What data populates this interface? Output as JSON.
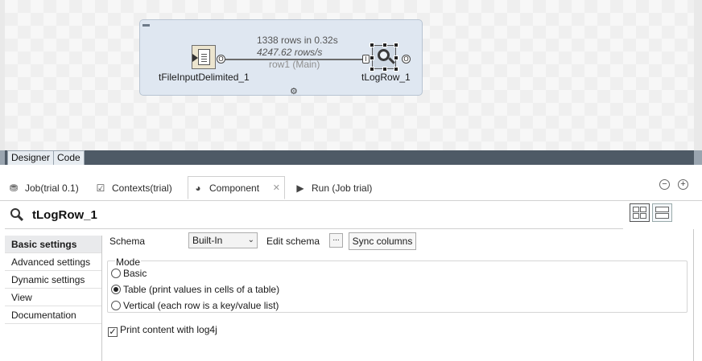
{
  "designer": {
    "stats_rows": "1338 rows in 0.32s",
    "stats_rate": "4247.62 rows/s",
    "flow_label": "row1 (Main)",
    "components": [
      {
        "label": "tFileInputDelimited_1",
        "icon": "file-input-icon"
      },
      {
        "label": "tLogRow_1",
        "icon": "magnifier-icon"
      }
    ],
    "port_labels": {
      "out": "O",
      "in": "I"
    }
  },
  "editor_tabs": [
    {
      "label": "Designer",
      "active": true
    },
    {
      "label": "Code",
      "active": false
    }
  ],
  "view_tabs": [
    {
      "label": "Job(trial 0.1)",
      "icon": "job-icon"
    },
    {
      "label": "Contexts(trial)",
      "icon": "contexts-icon"
    },
    {
      "label": "Component",
      "icon": "palette-icon",
      "active": true
    },
    {
      "label": "Run (Job trial)",
      "icon": "run-icon"
    }
  ],
  "window_controls": {
    "minimize": "−",
    "maximize": "+"
  },
  "component": {
    "title": "tLogRow_1"
  },
  "side_nav": [
    {
      "label": "Basic settings",
      "active": true
    },
    {
      "label": "Advanced settings"
    },
    {
      "label": "Dynamic settings"
    },
    {
      "label": "View"
    },
    {
      "label": "Documentation"
    }
  ],
  "settings": {
    "schema_label": "Schema",
    "schema_value": "Built-In",
    "edit_schema_label": "Edit schema",
    "edit_schema_button": "...",
    "sync_columns_label": "Sync columns",
    "mode_legend": "Mode",
    "modes": [
      {
        "label": "Basic",
        "checked": false
      },
      {
        "label": "Table (print values in cells of a table)",
        "checked": true
      },
      {
        "label": "Vertical (each row is a key/value list)",
        "checked": false
      }
    ],
    "log4j_label": "Print content with log4j",
    "log4j_checked": true
  },
  "colors": {
    "subjob_bg": "#dfe7f1",
    "active_nav_bg": "#e9eaec",
    "tab_strip_dark": "#4e5a66"
  }
}
